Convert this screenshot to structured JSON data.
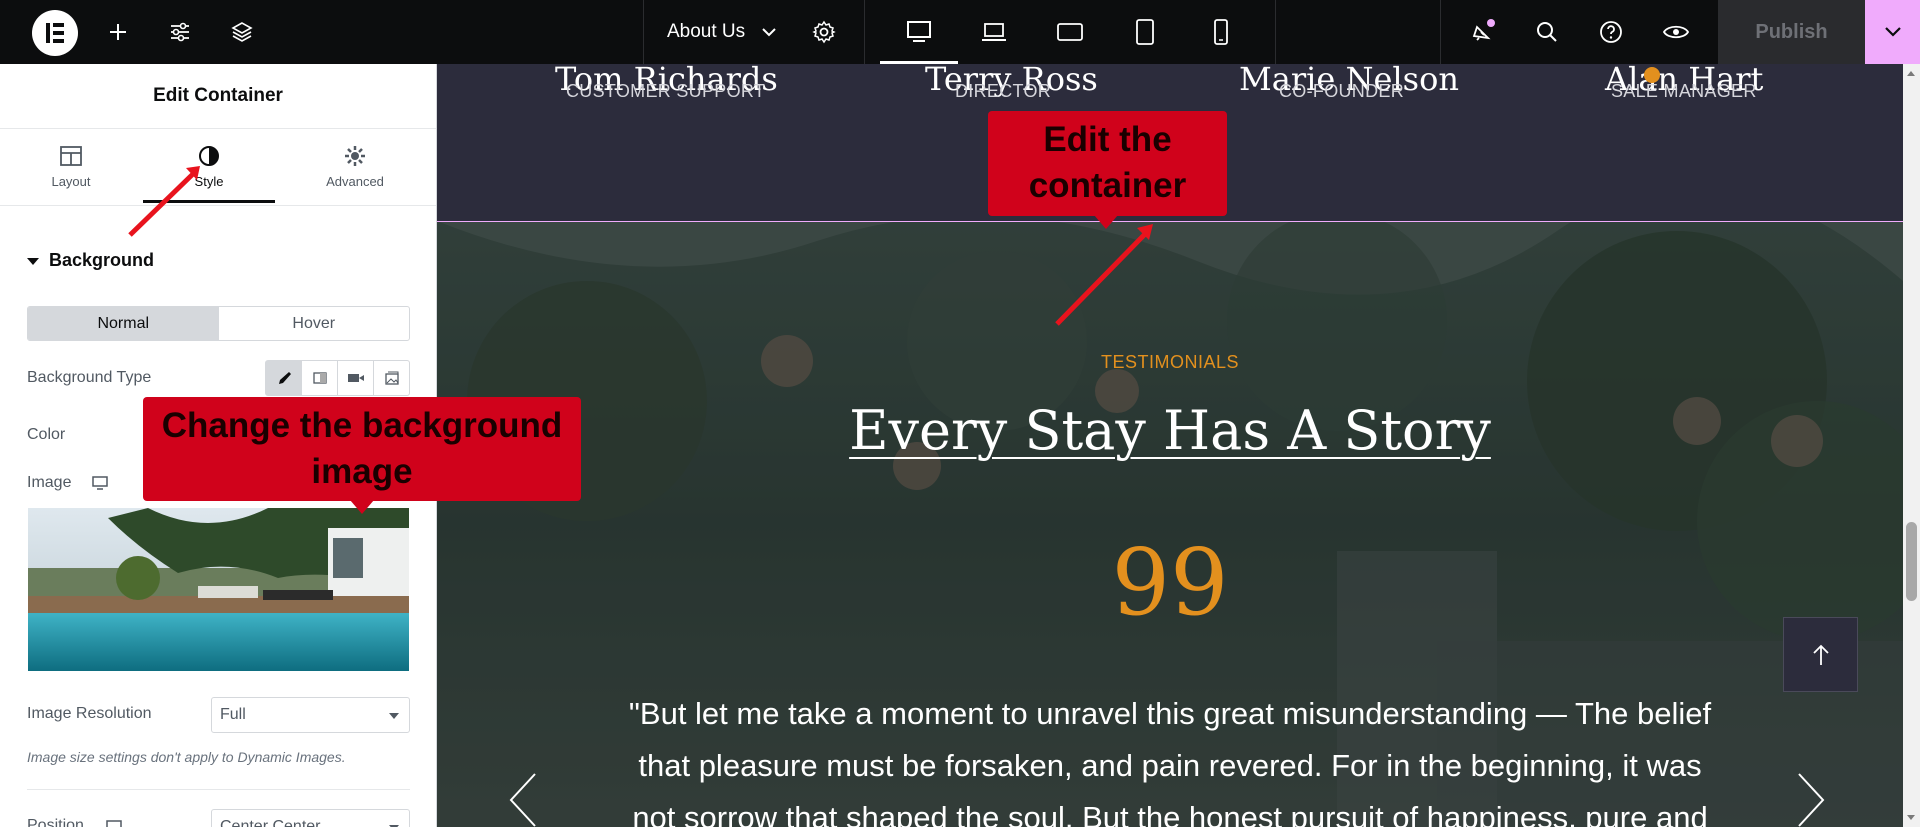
{
  "topbar": {
    "page_name": "About Us",
    "publish_label": "Publish",
    "icons": [
      "elementor-logo-icon",
      "add-icon",
      "sliders-icon",
      "layers-icon",
      "chevron-down-icon",
      "settings-icon",
      "desktop-icon",
      "laptop-icon",
      "tablet-landscape-icon",
      "tablet-icon",
      "mobile-icon",
      "notifications-icon",
      "search-icon",
      "help-icon",
      "preview-eye-icon"
    ]
  },
  "panel": {
    "title": "Edit Container",
    "tabs": [
      {
        "label": "Layout",
        "icon": "layout-icon"
      },
      {
        "label": "Style",
        "icon": "style-contrast-icon"
      },
      {
        "label": "Advanced",
        "icon": "gear-icon"
      }
    ],
    "section_title": "Background",
    "state_toggle": {
      "normal": "Normal",
      "hover": "Hover"
    },
    "background_type_label": "Background Type",
    "color_label": "Color",
    "image_label": "Image",
    "image_resolution_label": "Image Resolution",
    "image_resolution_value": "Full",
    "image_note": "Image size settings don't apply to Dynamic Images.",
    "position_label": "Position",
    "position_value": "Center Center"
  },
  "callouts": {
    "edit_container": "Edit the container",
    "change_bg": "Change the background image"
  },
  "team": [
    {
      "name": "Tom Richards",
      "role": "CUSTOMER SUPPORT"
    },
    {
      "name": "Terry Ross",
      "role": "DIRECTOR"
    },
    {
      "name": "Marie Nelson",
      "role": "CO-FOUNDER"
    },
    {
      "name": "Alan Hart",
      "role": "SALE MANAGER"
    }
  ],
  "testimonials": {
    "eyebrow": "TESTIMONIALS",
    "heading": "Every Stay Has A Story",
    "quote_mark": "99",
    "quote": "\"But let me take a moment to unravel this great misunderstanding — The belief that pleasure must be forsaken, and pain revered. For in the beginning, it was not sorrow that shaped the soul. But the honest pursuit of happiness, pure and"
  },
  "colors": {
    "accent": "#e3901e",
    "callout": "#d0021b",
    "topbar": "#0c0d0e",
    "team_bg": "#2c2c3c",
    "publish_arrow": "#f0abfc"
  }
}
